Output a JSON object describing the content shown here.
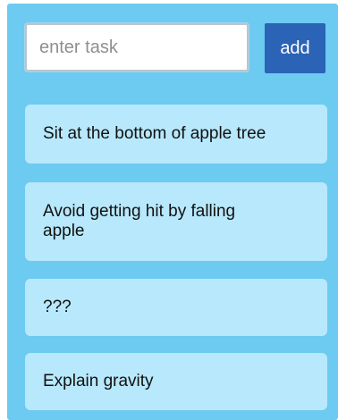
{
  "input": {
    "placeholder": "enter task",
    "value": ""
  },
  "add_button": {
    "label": "add"
  },
  "colors": {
    "background": "#6dcaf1",
    "task_card": "#b8e8fb",
    "add_button": "#2b63b7"
  },
  "tasks": [
    {
      "text": "Sit at the bottom of apple tree"
    },
    {
      "text": "Avoid getting hit by falling apple"
    },
    {
      "text": "???"
    },
    {
      "text": "Explain gravity"
    }
  ]
}
